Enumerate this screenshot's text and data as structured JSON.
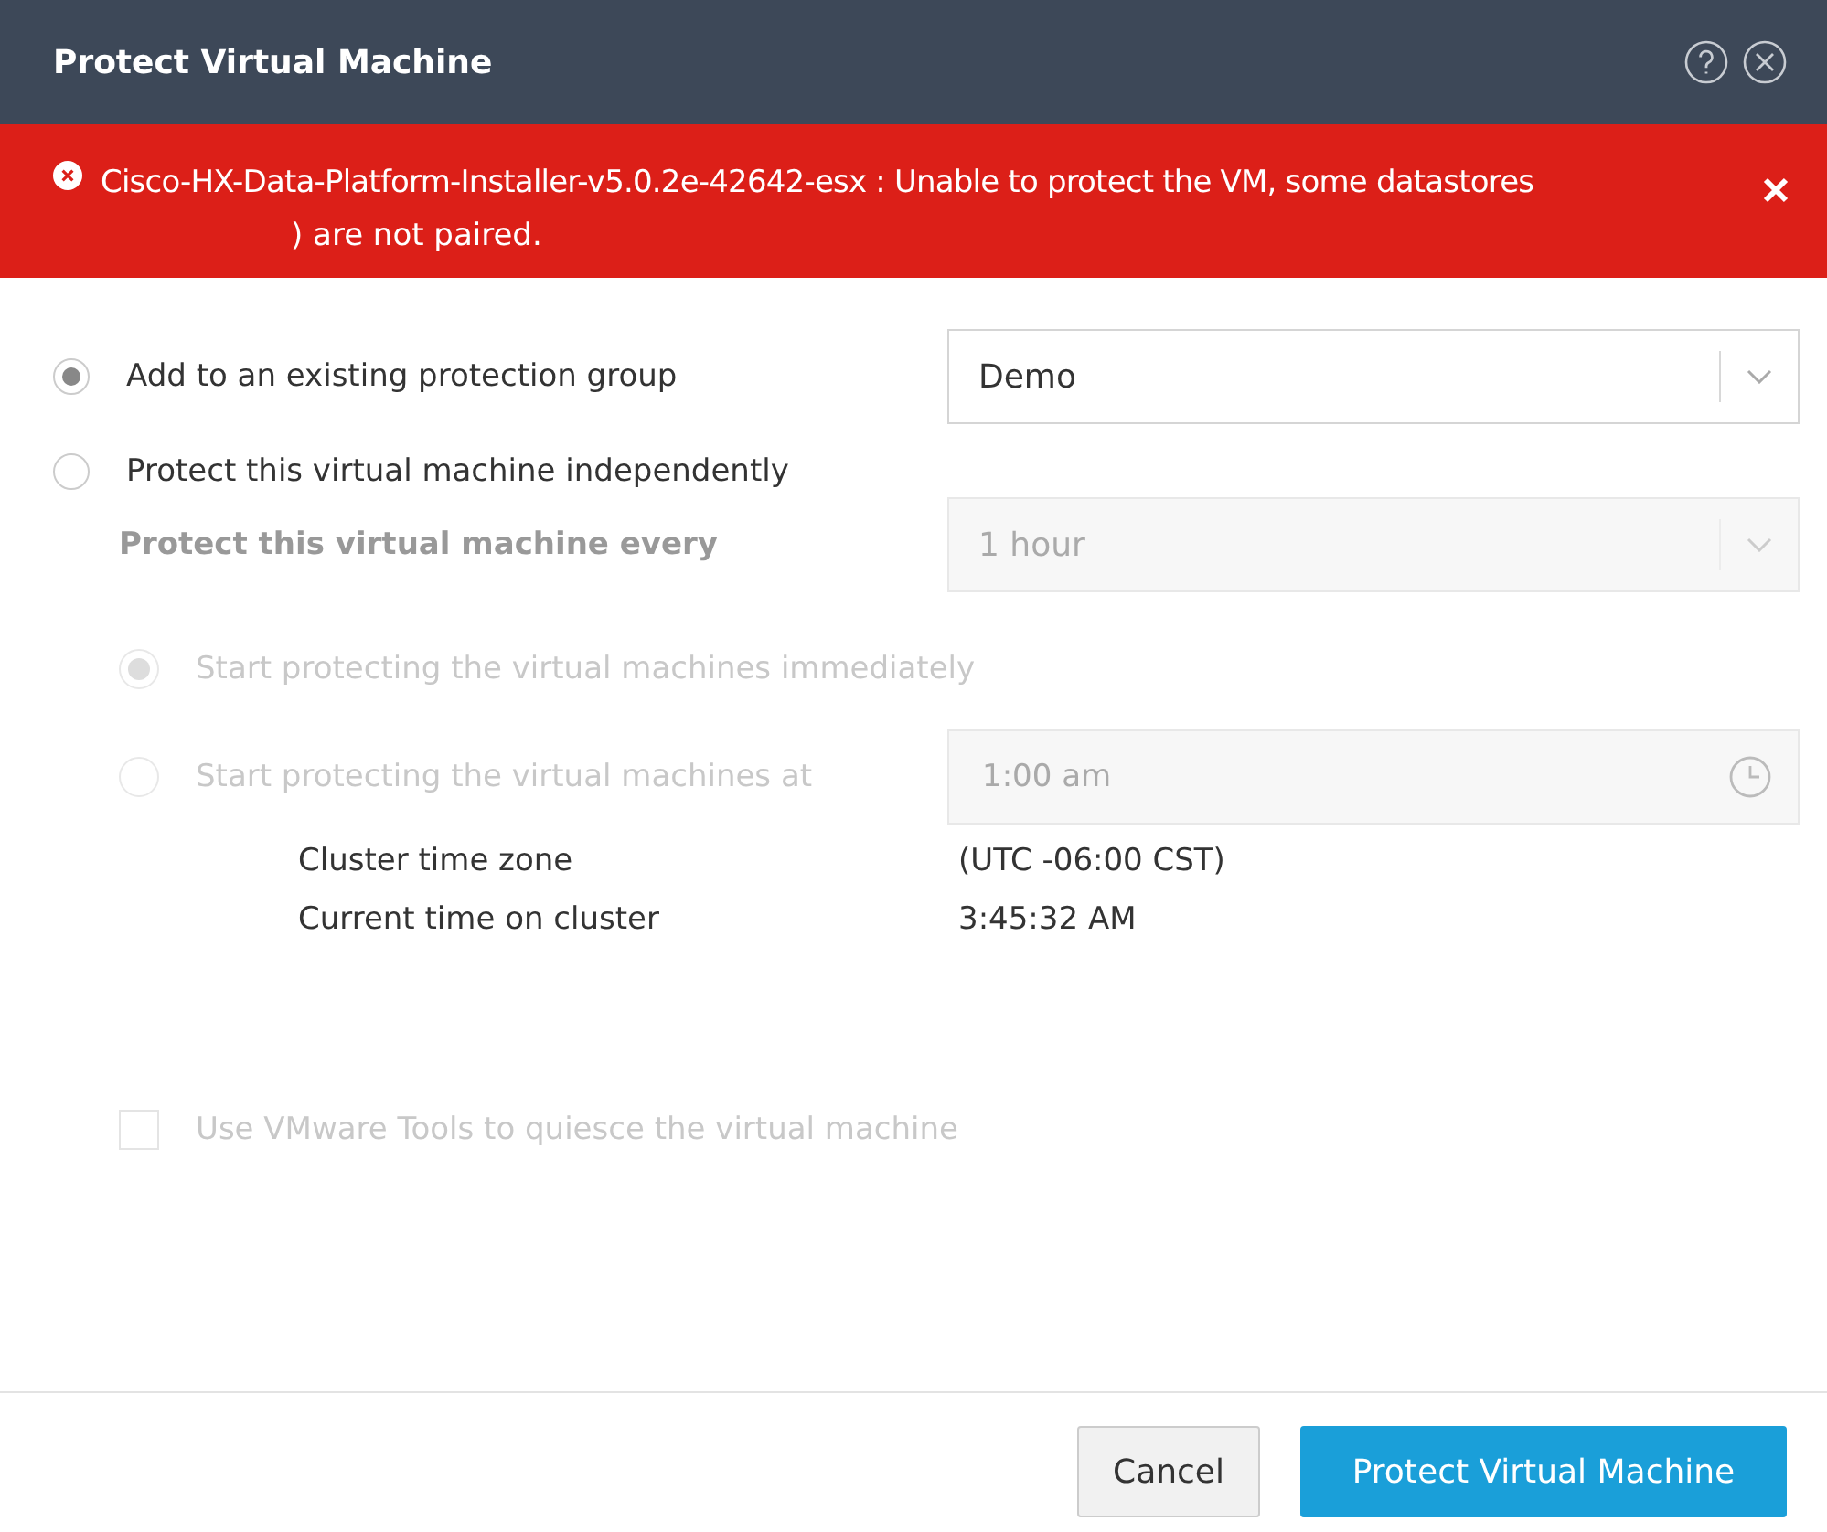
{
  "window": {
    "title": "Protect Virtual Machine"
  },
  "error": {
    "message": "Cisco-HX-Data-Platform-Installer-v5.0.2e-42642-esx : Unable to protect the VM, some datastores",
    "continuation": ") are not paired."
  },
  "protection_modes": [
    {
      "label": "Add to an existing protection group",
      "selected": true,
      "dropdown": "Demo"
    },
    {
      "label": "Protect this virtual machine independently",
      "selected": false
    }
  ],
  "interval": {
    "label": "Protect this virtual machine every",
    "value": "1 hour",
    "disabled": true
  },
  "start_options": [
    {
      "label": "Start protecting the virtual machines immediately",
      "selected": true,
      "disabled": true
    },
    {
      "label": "Start protecting the virtual machines at",
      "selected": false,
      "disabled": true,
      "time": "1:00 am"
    }
  ],
  "cluster_info": [
    {
      "label": "Cluster time zone",
      "value": "(UTC -06:00 CST)"
    },
    {
      "label": "Current time on cluster",
      "value": "3:45:32 AM"
    }
  ],
  "quiesce": {
    "label": "Use VMware Tools to quiesce the virtual machine",
    "checked": false,
    "disabled": true
  },
  "buttons": [
    {
      "label": "Cancel",
      "kind": "secondary"
    },
    {
      "label": "Protect Virtual Machine",
      "kind": "primary"
    }
  ]
}
